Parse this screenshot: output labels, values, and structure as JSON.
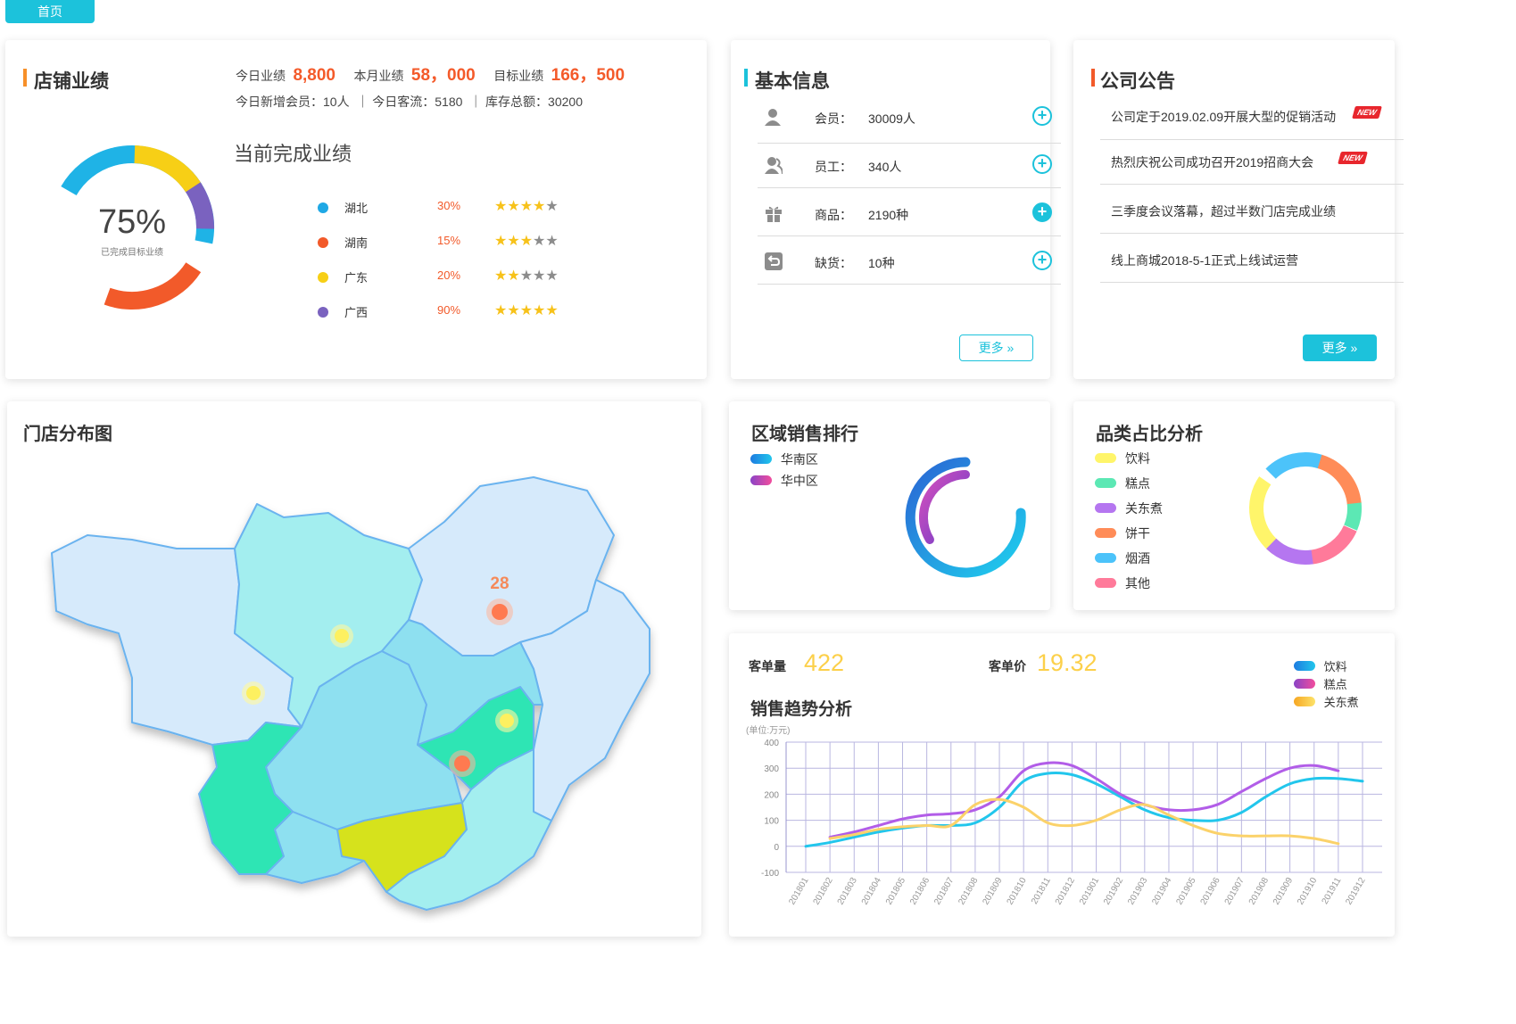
{
  "nav": {
    "home_tab": "首页"
  },
  "store": {
    "title": "店铺业绩",
    "today_label": "今日业绩",
    "today_value": "8,800",
    "month_label": "本月业绩",
    "month_value": "58，000",
    "target_label": "目标业绩",
    "target_value": "166，500",
    "stats_line": "今日新增会员：10人  ｜ 今日客流：5180  ｜ 库存总额：30200",
    "section_title": "当前完成业绩",
    "donut_percent": "75%",
    "donut_caption": "已完成目标业绩",
    "regions": [
      {
        "name": "湖北",
        "percent": "30%",
        "stars": 4,
        "color": "#1fa8e5"
      },
      {
        "name": "湖南",
        "percent": "15%",
        "stars": 3,
        "color": "#f25a2a"
      },
      {
        "name": "广东",
        "percent": "20%",
        "stars": 2,
        "color": "#f7cf16"
      },
      {
        "name": "广西",
        "percent": "90%",
        "stars": 5,
        "color": "#7a62bf"
      }
    ]
  },
  "basic_info": {
    "title": "基本信息",
    "rows": [
      {
        "label": "会员：",
        "value": "30009人",
        "icon": "user-icon"
      },
      {
        "label": "员工：",
        "value": "340人",
        "icon": "users-icon"
      },
      {
        "label": "商品：",
        "value": "2190种",
        "icon": "gift-icon"
      },
      {
        "label": "缺货：",
        "value": "10种",
        "icon": "return-icon"
      }
    ],
    "more": "更多"
  },
  "notices": {
    "title": "公司公告",
    "items": [
      {
        "text": "公司定于2019.02.09开展大型的促销活动",
        "new": true
      },
      {
        "text": "热烈庆祝公司成功召开2019招商大会",
        "new": true
      },
      {
        "text": "三季度会议落幕，超过半数门店完成业绩",
        "new": false
      },
      {
        "text": "线上商城2018-5-1正式上线试运营",
        "new": false
      }
    ],
    "new_tag": "NEW",
    "more": "更多"
  },
  "map": {
    "title": "门店分布图",
    "marker_value": "28"
  },
  "region_rank": {
    "title": "区域销售排行",
    "legend": [
      "华南区",
      "华中区"
    ]
  },
  "category": {
    "title": "品类占比分析",
    "legend": [
      {
        "name": "饮料",
        "color": "#fff56a"
      },
      {
        "name": "糕点",
        "color": "#5ce8b4"
      },
      {
        "name": "关东煮",
        "color": "#b576f0"
      },
      {
        "name": "饼干",
        "color": "#ff8c58"
      },
      {
        "name": "烟酒",
        "color": "#4cc3fa"
      },
      {
        "name": "其他",
        "color": "#ff7a9a"
      }
    ]
  },
  "trend": {
    "order_count_label": "客单量",
    "order_count_value": "422",
    "order_price_label": "客单价",
    "order_price_value": "19.32",
    "title": "销售趋势分析",
    "unit": "(单位:万元)",
    "legend": [
      "饮料",
      "糕点",
      "关东煮"
    ]
  },
  "chart_data": {
    "type": "line",
    "title": "销售趋势分析",
    "ylabel": "(单位:万元)",
    "ylim": [
      -100,
      400
    ],
    "yticks": [
      400,
      300,
      200,
      100,
      0,
      -100
    ],
    "x": [
      "201801",
      "201802",
      "201803",
      "201804",
      "201805",
      "201806",
      "201807",
      "201808",
      "201809",
      "201810",
      "201811",
      "201812",
      "201901",
      "201902",
      "201903",
      "201904",
      "201905",
      "201906",
      "201907",
      "201908",
      "201909",
      "201910",
      "201911",
      "201912"
    ],
    "series": [
      {
        "name": "饮料",
        "color": "#22c6ec",
        "values": [
          0,
          15,
          35,
          55,
          70,
          80,
          80,
          90,
          150,
          250,
          280,
          275,
          240,
          190,
          140,
          110,
          100,
          100,
          130,
          190,
          240,
          260,
          260,
          250
        ]
      },
      {
        "name": "糕点",
        "color": "#b25de8",
        "values": [
          null,
          35,
          55,
          80,
          105,
          120,
          125,
          140,
          190,
          290,
          320,
          310,
          260,
          200,
          160,
          140,
          140,
          160,
          210,
          260,
          300,
          310,
          290,
          null
        ]
      },
      {
        "name": "关东煮",
        "color": "#fbd26a",
        "values": [
          null,
          30,
          45,
          65,
          75,
          80,
          80,
          160,
          180,
          150,
          90,
          80,
          100,
          140,
          160,
          120,
          80,
          50,
          40,
          40,
          40,
          30,
          10,
          null
        ]
      }
    ]
  }
}
